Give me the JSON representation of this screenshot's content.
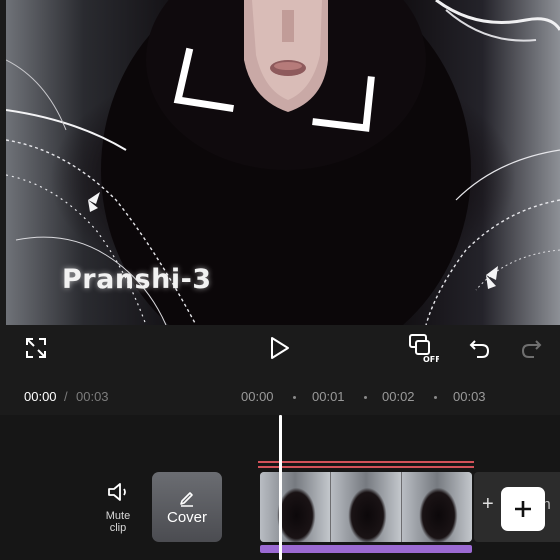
{
  "preview": {
    "overlay_text": "Pranshi-3",
    "icons": [
      "focus-bracket-icon",
      "butterfly-icon"
    ]
  },
  "toolbar": {
    "fullscreen_icon": "fullscreen-icon",
    "play_icon": "play-icon",
    "keyframe_icon": "keyframe-off-icon",
    "undo_icon": "undo-icon",
    "redo_icon": "redo-icon",
    "keyframe_badge": "OFF"
  },
  "time": {
    "current": "00:00",
    "separator": "/",
    "total": "00:03",
    "ruler": [
      "00:00",
      "00:01",
      "00:02",
      "00:03"
    ]
  },
  "track": {
    "mute_label_line1": "Mute",
    "mute_label_line2": "clip",
    "cover_label": "Cover",
    "add_end_plus": "+",
    "add_end_text": "en",
    "add_button": "+"
  },
  "colors": {
    "background": "#1b1b1b",
    "track_bg": "#161616",
    "playhead": "#ffffff",
    "audio_bar": "#9b6ad3",
    "red_line": "#d2525a"
  }
}
